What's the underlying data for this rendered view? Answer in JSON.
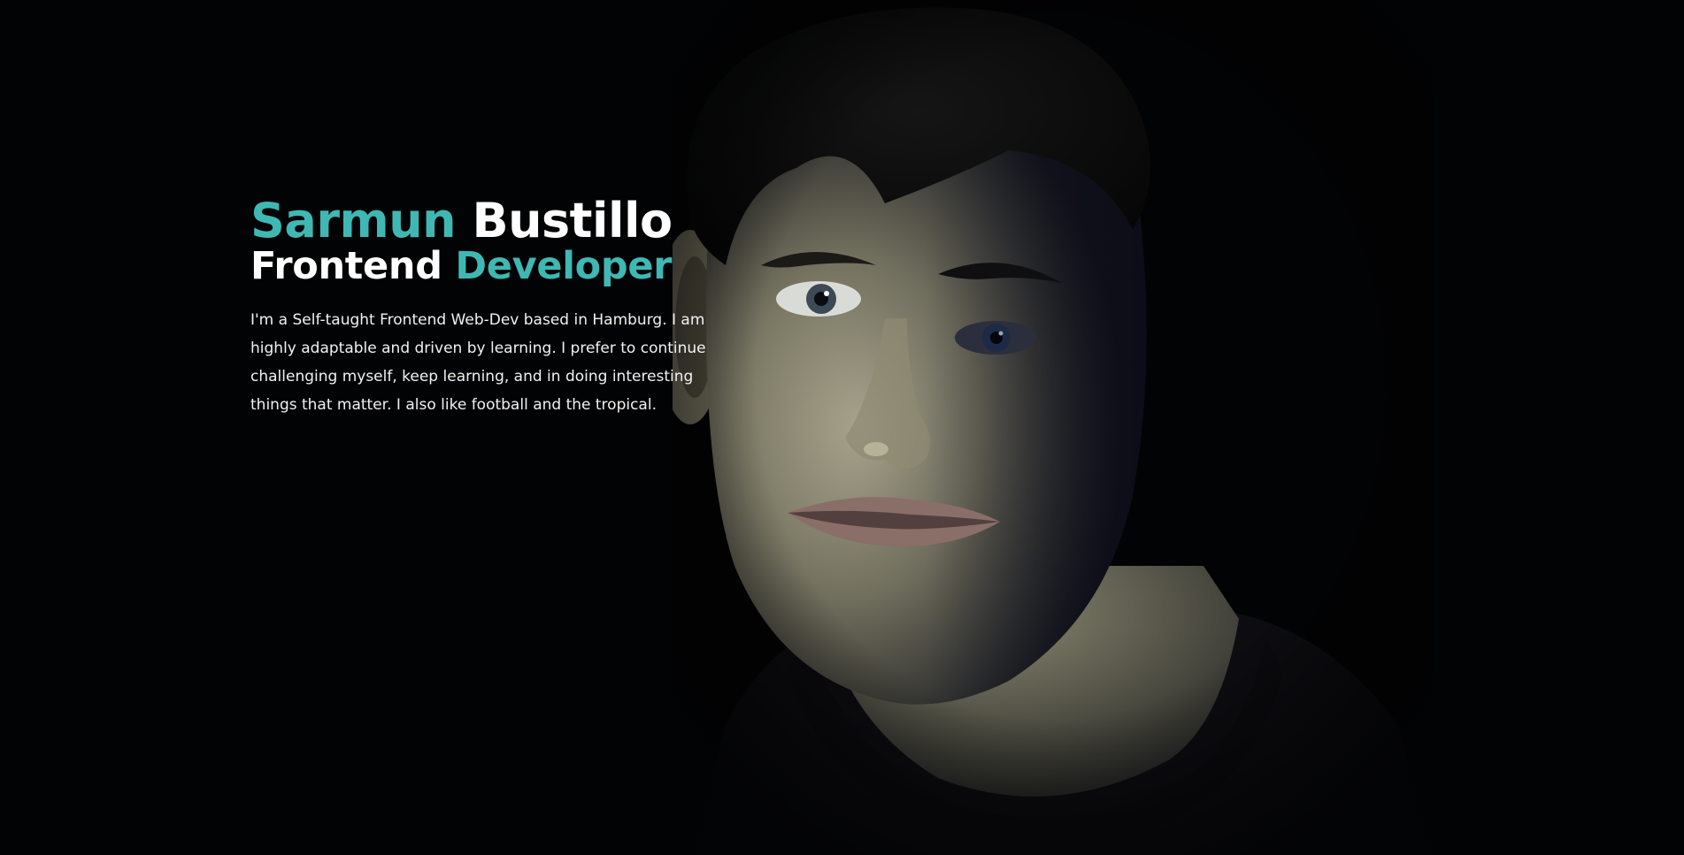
{
  "hero": {
    "first_name": "Sarmun",
    "last_name": "Bustillo",
    "role_word_1": "Frontend",
    "role_word_2": "Developer",
    "bio": "I'm a Self-taught Frontend Web-Dev based in Hamburg. I am highly adaptable and driven by learning. I prefer to continue challenging myself, keep learning, and in doing interesting things that matter. I also like football and the tropical."
  },
  "colors": {
    "background": "#020304",
    "accent": "#3fb8b4",
    "text": "#ffffff"
  }
}
